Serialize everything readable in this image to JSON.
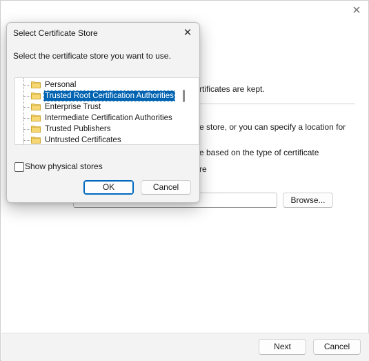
{
  "wizard": {
    "close_glyph": "✕",
    "line1": "rtificates are kept.",
    "line2": "e store, or you can specify a location for",
    "line3": "e based on the type of certificate",
    "line4": "re",
    "browse_label": "Browse...",
    "next_label": "Next",
    "cancel_label": "Cancel"
  },
  "dialog": {
    "title": "Select Certificate Store",
    "close_glyph": "✕",
    "prompt": "Select the certificate store you want to use.",
    "stores": [
      {
        "label": "Personal",
        "selected": false
      },
      {
        "label": "Trusted Root Certification Authorities",
        "selected": true
      },
      {
        "label": "Enterprise Trust",
        "selected": false
      },
      {
        "label": "Intermediate Certification Authorities",
        "selected": false
      },
      {
        "label": "Trusted Publishers",
        "selected": false
      },
      {
        "label": "Untrusted Certificates",
        "selected": false
      }
    ],
    "show_physical_label": "Show physical stores",
    "show_physical_checked": false,
    "ok_label": "OK",
    "cancel_label": "Cancel"
  },
  "colors": {
    "accent": "#0067c0",
    "selection": "#0063b1",
    "folder": "#f7d774"
  }
}
